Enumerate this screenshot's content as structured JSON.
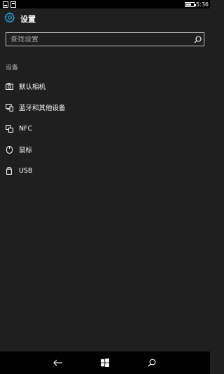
{
  "status_bar": {
    "time": "5:36",
    "left_icons": [
      "notification-icon",
      "notification-icon"
    ]
  },
  "header": {
    "title": "设置",
    "icon": "gear-icon"
  },
  "search": {
    "placeholder": "查找设置",
    "value": "",
    "icon": "search-icon"
  },
  "section": {
    "title": "设备"
  },
  "items": [
    {
      "label": "默认相机",
      "icon": "camera-icon"
    },
    {
      "label": "蓝牙和其他设备",
      "icon": "devices-icon"
    },
    {
      "label": "NFC",
      "icon": "nfc-icon"
    },
    {
      "label": "鼠标",
      "icon": "mouse-icon"
    },
    {
      "label": "USB",
      "icon": "usb-icon"
    }
  ],
  "navbar": {
    "buttons": [
      "back-icon",
      "windows-icon",
      "search-icon"
    ]
  },
  "colors": {
    "background": "#1f1f1f",
    "accent": "#2d9fd8",
    "bars": "#000000"
  }
}
